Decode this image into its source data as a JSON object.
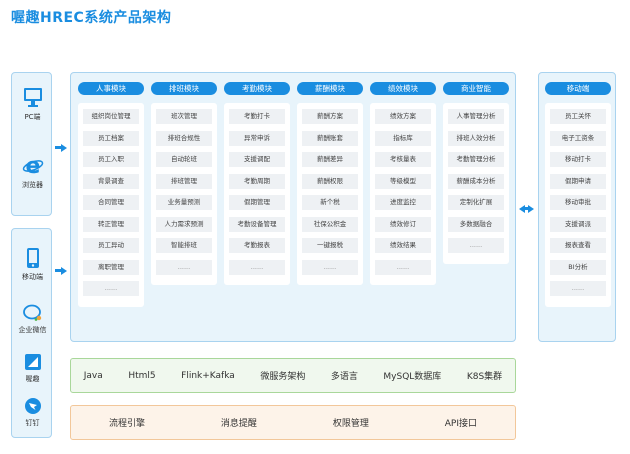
{
  "title": "喔趣HREC系统产品架构",
  "clients_top": [
    {
      "label": "PC端",
      "icon": "pc-icon"
    },
    {
      "label": "浏览器",
      "icon": "ie-browser-icon"
    }
  ],
  "clients_bottom": [
    {
      "label": "移动端",
      "icon": "mobile-icon"
    },
    {
      "label": "企业微信",
      "icon": "wecom-icon"
    },
    {
      "label": "喔趣",
      "icon": "woqu-icon"
    },
    {
      "label": "钉钉",
      "icon": "dingtalk-icon"
    }
  ],
  "modules": [
    {
      "title": "人事模块",
      "items": [
        "组织岗位管理",
        "员工档案",
        "员工入职",
        "背景调查",
        "合同管理",
        "转正管理",
        "员工异动",
        "离职管理",
        "......"
      ]
    },
    {
      "title": "排班模块",
      "items": [
        "班次管理",
        "排班合规性",
        "自动轮班",
        "排班管理",
        "业务量预测",
        "人力需求预测",
        "智能排班",
        "......"
      ]
    },
    {
      "title": "考勤模块",
      "items": [
        "考勤打卡",
        "异常申诉",
        "支援调配",
        "考勤周期",
        "假期管理",
        "考勤设备管理",
        "考勤报表",
        "......"
      ]
    },
    {
      "title": "薪酬模块",
      "items": [
        "薪酬方案",
        "薪酬账套",
        "薪酬差异",
        "薪酬权限",
        "新个税",
        "社保公积金",
        "一键报税",
        "......"
      ]
    },
    {
      "title": "绩效模块",
      "items": [
        "绩效方案",
        "指标库",
        "考核量表",
        "等级模型",
        "进度监控",
        "绩效修订",
        "绩效结果",
        "......"
      ]
    },
    {
      "title": "商业智能",
      "items": [
        "人事管理分析",
        "排班人效分析",
        "考勤管理分析",
        "薪酬成本分析",
        "定制化扩展",
        "多数据融合",
        "......"
      ]
    }
  ],
  "mobile": {
    "title": "移动端",
    "items": [
      "员工关怀",
      "电子工资条",
      "移动打卡",
      "假期申请",
      "移动审批",
      "支援调派",
      "报表查看",
      "BI分析",
      "......"
    ]
  },
  "tech_stack": [
    "Java",
    "Html5",
    "Flink+Kafka",
    "微服务架构",
    "多语言",
    "MySQL数据库",
    "K8S集群"
  ],
  "infrastructure": [
    "流程引擎",
    "消息提醒",
    "权限管理",
    "API接口"
  ],
  "colors": {
    "accent": "#1a8de0",
    "tech_band": "#f0f8ee",
    "infra_band": "#fdf3e9"
  }
}
